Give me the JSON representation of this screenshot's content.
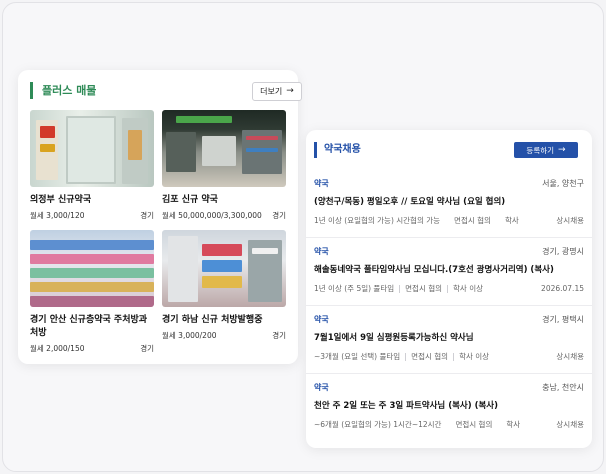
{
  "places": {
    "title": "플러스 매물",
    "more_label": "더보기",
    "listings": [
      {
        "name": "의정부 신규약국",
        "price": "월세 3,000/120",
        "region": "경기"
      },
      {
        "name": "김포 신규 약국",
        "price": "월세 50,000,000/3,300,000",
        "region": "경기"
      },
      {
        "name": "경기 안산 신규층약국 주처방과처방",
        "price": "월세 2,000/150",
        "region": "경기"
      },
      {
        "name": "경기 하남 신규 처방발행중",
        "price": "월세 3,000/200",
        "region": "경기"
      }
    ]
  },
  "jobs": {
    "title": "약국채용",
    "register_label": "등록하기",
    "items": [
      {
        "type": "약국",
        "location": "서울, 양천구",
        "title": "(양천구/목동) 평일오후 // 토요일 약사님 (요일 협의)",
        "conditions": [
          "1년 이상 (요일협의 가능) 시간협의 가능",
          "면접시 협의",
          "학사"
        ],
        "status": "상시채용",
        "style": "spaced"
      },
      {
        "type": "약국",
        "location": "경기, 광명시",
        "title": "해솔동네약국 풀타임약사님 모십니다.(7호선 광명사거리역) (복사)",
        "conditions": [
          "1년 이상 (주 5일) 풀타임",
          "면접시 협의",
          "학사 이상"
        ],
        "status": "2026.07.15",
        "style": "pipes"
      },
      {
        "type": "약국",
        "location": "경기, 평택시",
        "title": "7월1일에서 9일 심평원등록가능하신 약사님",
        "conditions": [
          "~3개월 (요일 선택) 풀타임",
          "면접시 협의",
          "학사 이상"
        ],
        "status": "상시채용",
        "style": "pipes"
      },
      {
        "type": "약국",
        "location": "충남, 천안시",
        "title": "천안 주 2일 또는 주 3일 파트약사님 (복사) (복사)",
        "conditions": [
          "~6개월 (요일협의 가능) 1시간~12시간",
          "면접시 협의",
          "학사"
        ],
        "status": "상시채용",
        "style": "spaced"
      }
    ]
  },
  "colors": {
    "green_accent": "#2e8b57",
    "blue_accent": "#2451a8"
  },
  "icons": {
    "more_arrow": "arrow-right-icon",
    "register_arrow": "arrow-right-icon"
  }
}
